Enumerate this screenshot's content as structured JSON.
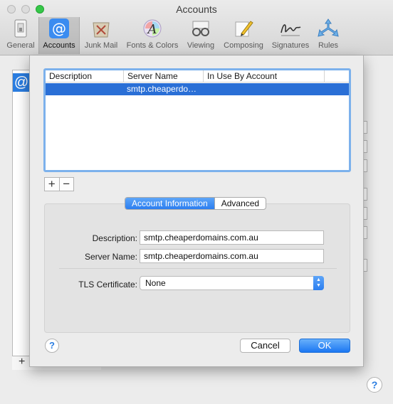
{
  "window": {
    "title": "Accounts"
  },
  "toolbar": {
    "items": [
      {
        "label": "General",
        "icon": "general-icon"
      },
      {
        "label": "Accounts",
        "icon": "at-sign-icon",
        "active": true
      },
      {
        "label": "Junk Mail",
        "icon": "junk-mail-icon"
      },
      {
        "label": "Fonts & Colors",
        "icon": "fonts-colors-icon"
      },
      {
        "label": "Viewing",
        "icon": "glasses-icon"
      },
      {
        "label": "Composing",
        "icon": "pencil-icon"
      },
      {
        "label": "Signatures",
        "icon": "signature-icon"
      },
      {
        "label": "Rules",
        "icon": "rules-icon"
      }
    ]
  },
  "sheet": {
    "table": {
      "columns": [
        "Description",
        "Server Name",
        "In Use By Account"
      ],
      "rows": [
        {
          "description": "",
          "server_name": "smtp.cheaperdo…",
          "in_use_by": ""
        }
      ]
    },
    "add_button": "+",
    "remove_button": "−",
    "tabs": {
      "account_info": "Account Information",
      "advanced": "Advanced"
    },
    "form": {
      "description_label": "Description:",
      "description_value": "smtp.cheaperdomains.com.au",
      "server_name_label": "Server Name:",
      "server_name_value": "smtp.cheaperdomains.com.au",
      "tls_label": "TLS Certificate:",
      "tls_value": "None"
    },
    "buttons": {
      "help": "?",
      "cancel": "Cancel",
      "ok": "OK"
    }
  },
  "background": {
    "help": "?",
    "add": "+",
    "selected_account_icon": "@"
  },
  "colors": {
    "accent": "#2c7ef0",
    "selection": "#2a6fd6"
  }
}
